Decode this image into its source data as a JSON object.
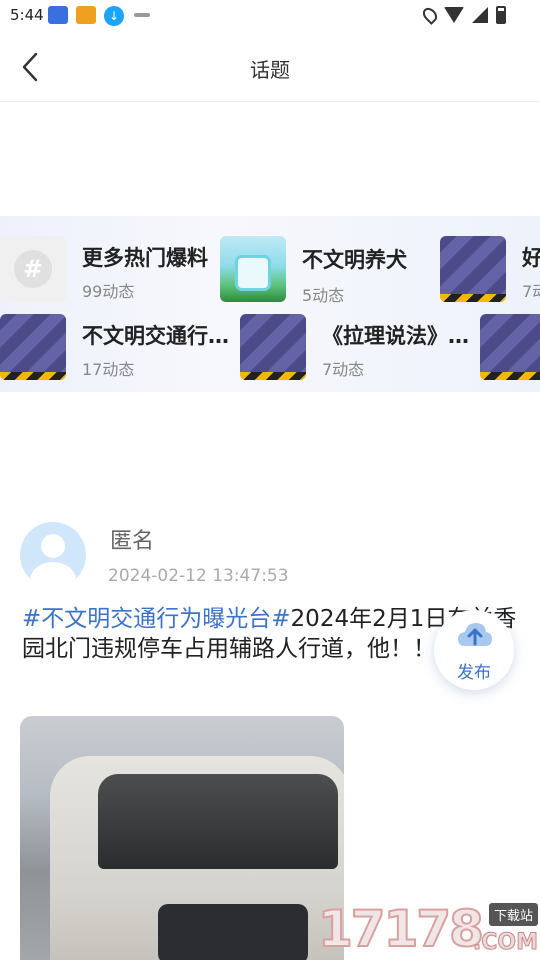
{
  "status_bar": {
    "time": "5:44",
    "icons": [
      "location-icon",
      "wifi-icon",
      "signal-icon",
      "battery-icon"
    ]
  },
  "header": {
    "title": "话题",
    "back_icon": "chevron-left-icon"
  },
  "topics": [
    {
      "name": "更多热门爆料",
      "count": "99动态",
      "thumb": "hash"
    },
    {
      "name": "不文明养犬",
      "count": "5动态",
      "thumb": "nature"
    },
    {
      "name": "好",
      "count": "7动",
      "thumb": "stripe"
    },
    {
      "name": "不文明交通行…",
      "count": "17动态",
      "thumb": "stripe"
    },
    {
      "name": "《拉理说法》…",
      "count": "7动态",
      "thumb": "stripe"
    },
    {
      "name": "",
      "count": "",
      "thumb": "stripe"
    }
  ],
  "post": {
    "author": "匿名",
    "time": "2024-02-12  13:47:53",
    "tag": "#不文明交通行为曝光台#",
    "text": "2024年2月1日在兰香园北门违规停车占用辅路人行道，他！！！"
  },
  "fab": {
    "label": "发布"
  },
  "watermark": {
    "number": "17178",
    "tag": "下载站",
    "suffix": ".COM"
  },
  "colors": {
    "accent": "#3b73c8",
    "topic_strip_bg": "#eef1fb"
  }
}
